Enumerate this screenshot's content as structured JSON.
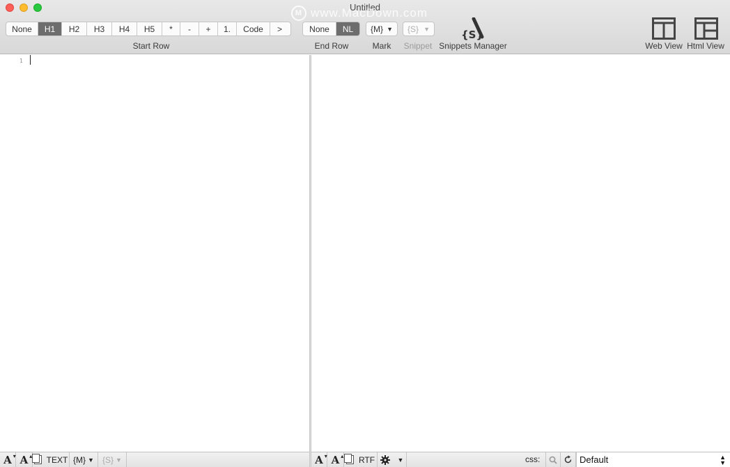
{
  "window": {
    "title": "Untitled",
    "watermark": "www.MacDown.com",
    "watermark_logo": "M"
  },
  "toolbar": {
    "start_row": {
      "label": "Start Row",
      "options": [
        "None",
        "H1",
        "H2",
        "H3",
        "H4",
        "H5",
        "*",
        "-",
        "+",
        "1.",
        "Code",
        ">"
      ],
      "selected": "H1"
    },
    "end_row": {
      "label": "End Row",
      "options": [
        "None",
        "NL"
      ],
      "selected": "NL"
    },
    "mark": {
      "label": "Mark",
      "value": "{M}"
    },
    "snippet": {
      "label": "Snippet",
      "value": "{S}",
      "enabled": false
    },
    "snippets_manager": {
      "label": "Snippets Manager",
      "icon": "snippets-manager-icon",
      "glyph": "{S}"
    },
    "web_view": {
      "label": "Web View",
      "icon": "two-column-layout-icon"
    },
    "html_view": {
      "label": "Html View",
      "icon": "split-layout-icon"
    }
  },
  "editor": {
    "line_numbers": [
      "1"
    ]
  },
  "bottom_left": {
    "decrease_font": "A",
    "decrease_font_mark": "▾",
    "increase_font": "A",
    "increase_font_mark": "▴",
    "copy_label": "TEXT",
    "mark_value": "{M}",
    "snippet_value": "{S}"
  },
  "bottom_right": {
    "decrease_font": "A",
    "decrease_font_mark": "▾",
    "increase_font": "A",
    "increase_font_mark": "▴",
    "copy_label": "RTF",
    "settings_icon": "gear-icon",
    "css_label": "css:",
    "css_select_value": "Default"
  },
  "colors": {
    "close": "#fe5f57",
    "minimize": "#febc2e",
    "maximize": "#28c840",
    "segment_active": "#6d6d6d"
  }
}
